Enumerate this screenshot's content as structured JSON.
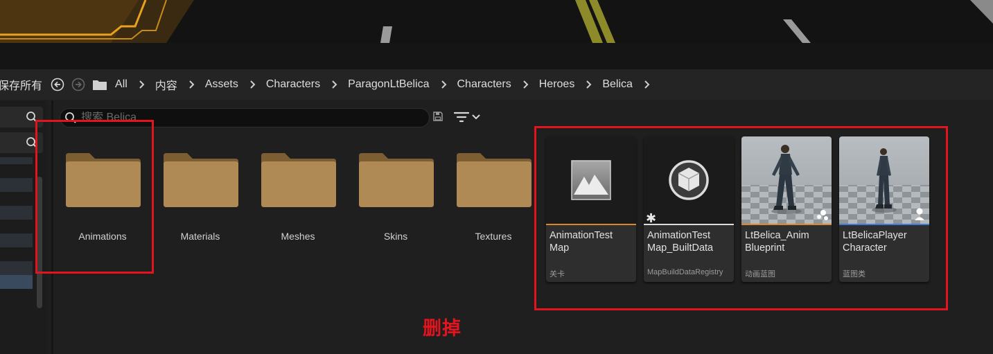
{
  "toolbar": {
    "save_all_label": "保存所有",
    "back_icon": "back-arrow-icon",
    "forward_icon": "forward-arrow-icon",
    "folder_icon": "folder-icon"
  },
  "breadcrumb": [
    "All",
    "内容",
    "Assets",
    "Characters",
    "ParagonLtBelica",
    "Characters",
    "Heroes",
    "Belica"
  ],
  "search": {
    "placeholder": "搜索 Belica",
    "value": ""
  },
  "folders": [
    {
      "label": "Animations"
    },
    {
      "label": "Materials"
    },
    {
      "label": "Meshes"
    },
    {
      "label": "Skins"
    },
    {
      "label": "Textures"
    }
  ],
  "assets": [
    {
      "name": "AnimationTest\nMap",
      "type": "关卡",
      "strip_color": "#d9892b",
      "icon": "level-icon"
    },
    {
      "name": "AnimationTest\nMap_BuiltData",
      "type": "MapBuildDataRegistry",
      "strip_color": "#dcdcdc",
      "icon": "mapbuilddata-icon"
    },
    {
      "name": "LtBelica_Anim\nBlueprint",
      "type": "动画蓝图",
      "strip_color": "#d9892b",
      "icon": "character-thumbnail"
    },
    {
      "name": "LtBelicaPlayer\nCharacter",
      "type": "蓝图类",
      "strip_color": "#3c7bd6",
      "icon": "character-thumbnail"
    }
  ],
  "annotation": {
    "text": "删掉",
    "color": "#e3141d"
  }
}
